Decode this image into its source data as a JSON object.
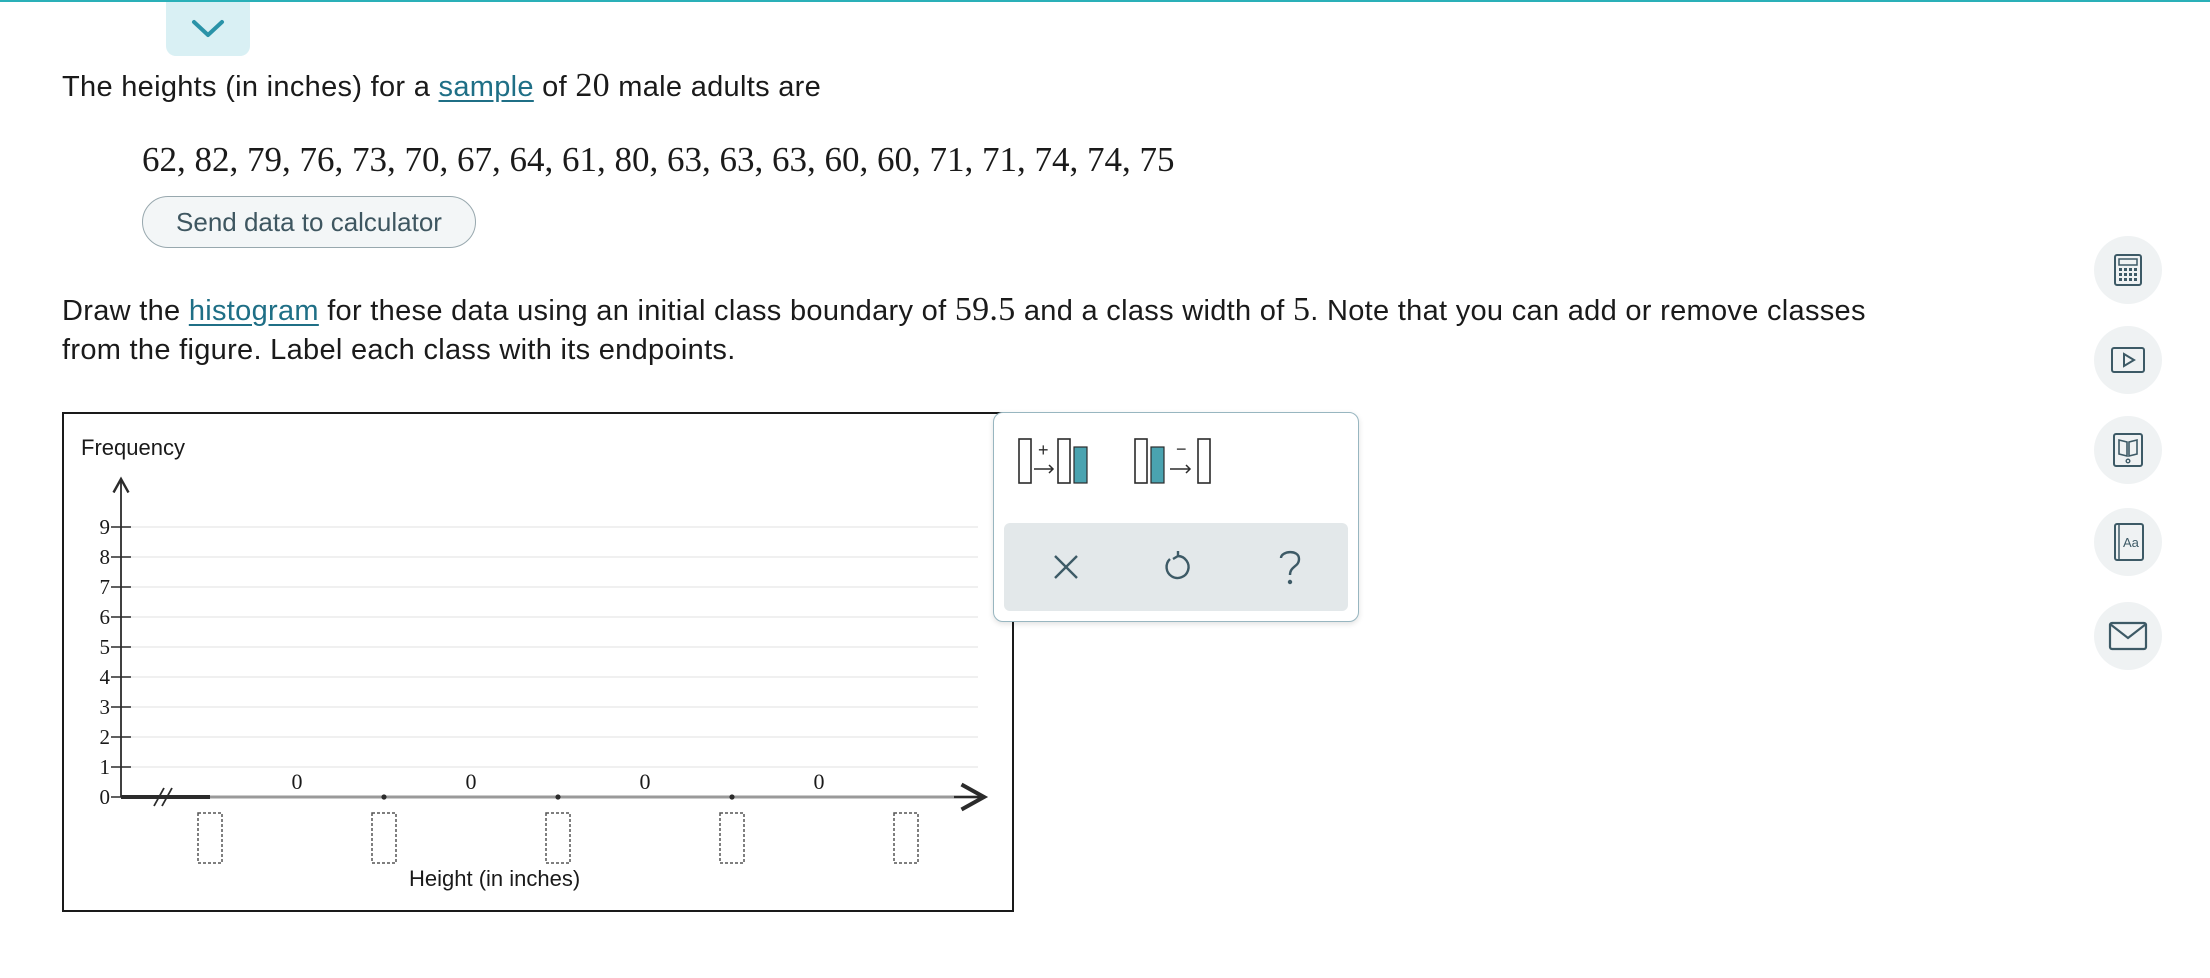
{
  "question": {
    "intro_before_link": "The heights (in inches) for a ",
    "intro_link": "sample",
    "intro_mid": " of ",
    "sample_size": "20",
    "intro_after": " male adults are",
    "data_values": "62, 82, 79, 76, 73, 70, 67, 64, 61, 80, 63, 63, 63, 60, 60, 71, 71, 74, 74, 75",
    "send_button_label": "Send data to calculator",
    "instr_before_link": "Draw the ",
    "instr_link": "histogram",
    "instr_mid1": " for these data using an initial class boundary of ",
    "initial_boundary": "59.5",
    "instr_mid2": " and a class width of ",
    "class_width": "5",
    "instr_end1": ". Note that you can add or remove classes",
    "instr_line2": "from the figure. Label each class with its endpoints."
  },
  "chart_data": {
    "type": "bar",
    "ylabel": "Frequency",
    "xlabel": "Height (in inches)",
    "ylim": [
      0,
      9
    ],
    "yticks": [
      "0",
      "1",
      "2",
      "3",
      "4",
      "5",
      "6",
      "7",
      "8",
      "9"
    ],
    "grid": true,
    "bar_count_labels": [
      "0",
      "0",
      "0",
      "0"
    ],
    "values": [
      0,
      0,
      0,
      0
    ],
    "endpoint_inputs": [
      "",
      "",
      "",
      "",
      ""
    ]
  },
  "tools": {
    "add_class": "add-class",
    "remove_class": "remove-class",
    "clear": "clear-icon",
    "undo": "undo-icon",
    "help": "help-icon"
  },
  "sidebar": [
    "calculator-icon",
    "video-icon",
    "ebook-icon",
    "glossary-icon",
    "message-icon"
  ],
  "colors": {
    "accent": "#2ab0b8",
    "link": "#1f6f86",
    "tool_teal": "#4aa3b0"
  }
}
